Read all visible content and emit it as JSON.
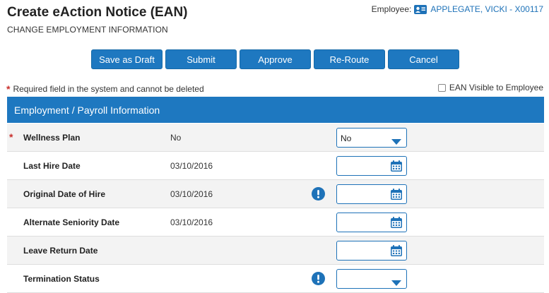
{
  "header": {
    "title": "Create eAction Notice (EAN)",
    "subtitle": "CHANGE EMPLOYMENT INFORMATION",
    "employee_label": "Employee:",
    "employee_name": "APPLEGATE, VICKI - X00117"
  },
  "toolbar": {
    "save_draft": "Save as Draft",
    "submit": "Submit",
    "approve": "Approve",
    "reroute": "Re-Route",
    "cancel": "Cancel"
  },
  "notes": {
    "required_marker": "*",
    "required_text": "Required field in the system and cannot be deleted",
    "visible_label": "EAN Visible to Employee"
  },
  "section": {
    "title": "Employment / Payroll Information"
  },
  "rows": [
    {
      "label": "Wellness Plan",
      "current": "No",
      "input_value": "No"
    },
    {
      "label": "Last Hire Date",
      "current": "03/10/2016",
      "input_value": ""
    },
    {
      "label": "Original Date of Hire",
      "current": "03/10/2016",
      "input_value": ""
    },
    {
      "label": "Alternate Seniority Date",
      "current": "03/10/2016",
      "input_value": ""
    },
    {
      "label": "Leave Return Date",
      "current": "",
      "input_value": ""
    },
    {
      "label": "Termination Status",
      "current": "",
      "input_value": ""
    }
  ],
  "icons": {
    "employee": "id-card-icon",
    "calendar": "calendar-icon",
    "dropdown": "chevron-down-icon",
    "alert": "exclamation-circle-icon"
  },
  "colors": {
    "primary": "#1e78c0",
    "link": "#1e72b8",
    "required": "#c9302c"
  }
}
